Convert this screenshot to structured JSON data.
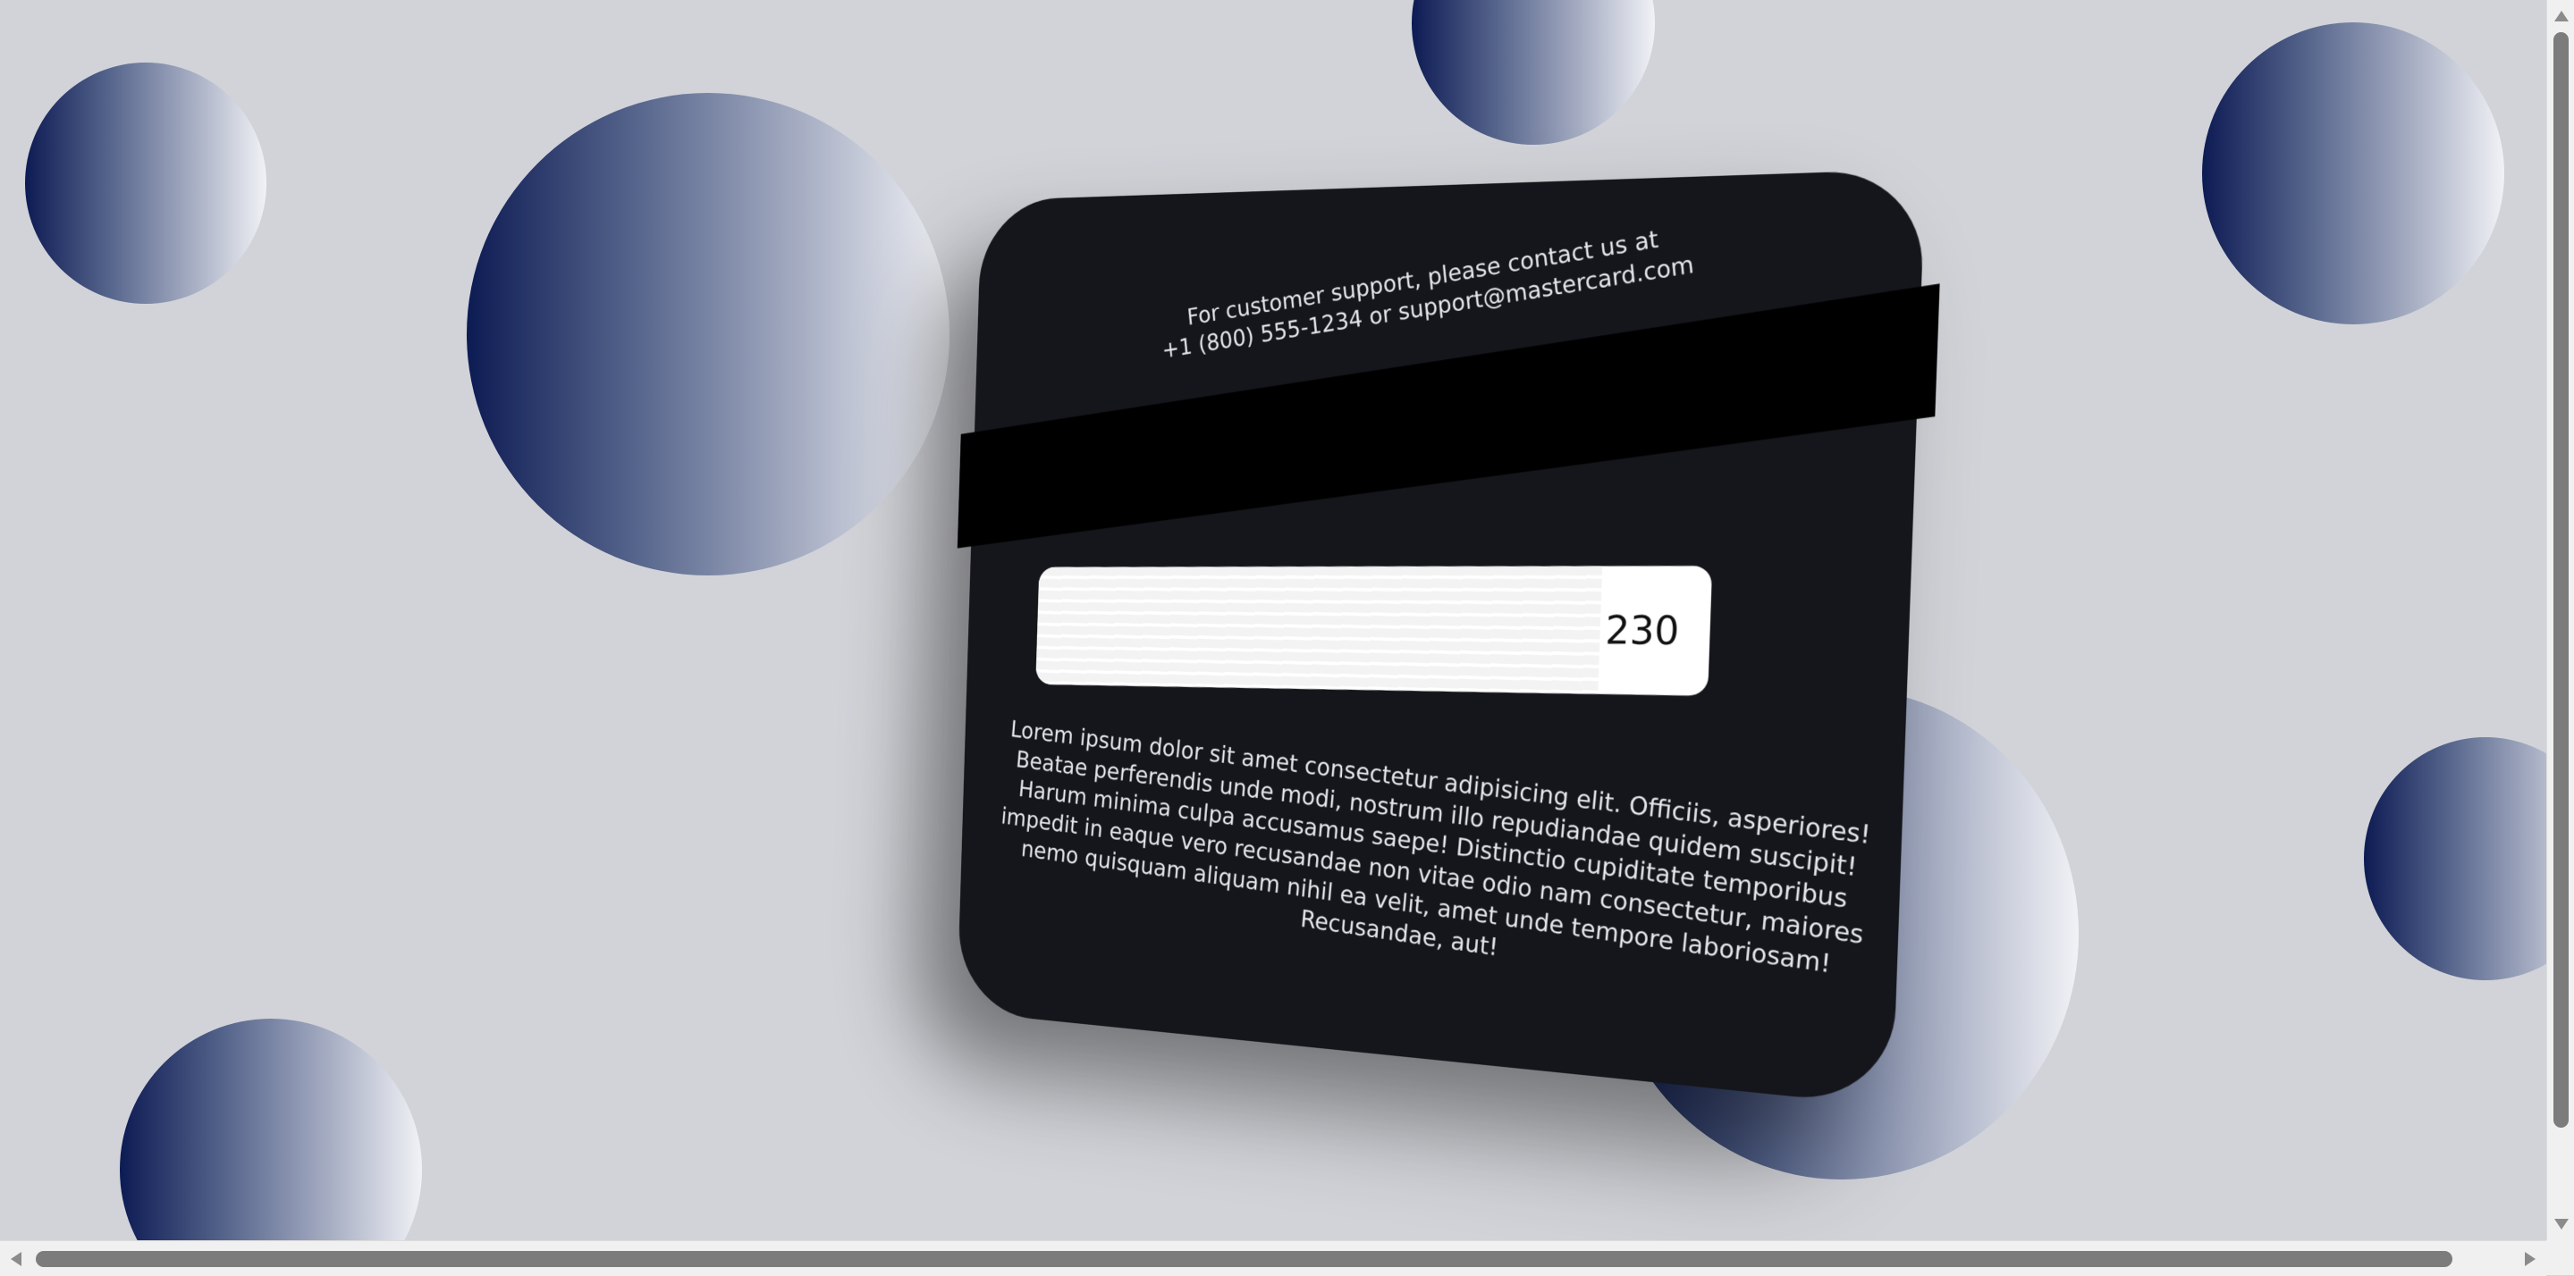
{
  "card": {
    "support_line1": "For customer support, please contact us at",
    "support_line2": "+1 (800) 555-1234 or support@mastercard.com",
    "cvv": "230",
    "legal_text": "Lorem ipsum dolor sit amet consectetur adipisicing elit. Officiis, asperiores! Beatae perferendis unde modi, nostrum illo repudiandae quidem suscipit! Harum minima culpa accusamus saepe! Distinctio cupiditate temporibus impedit in eaque vero recusandae non vitae odio nam consectetur, maiores nemo quisquam aliquam nihil ea velit, amet unde tempore laboriosam! Recusandae, aut!"
  },
  "colors": {
    "background": "#d1d3d8",
    "card": "#14161b",
    "magstripe": "#000000",
    "bubble_dark": "#0d1b54",
    "bubble_light": "#f1f2f6"
  },
  "scrollbars": {
    "vertical": "visible",
    "horizontal": "visible"
  }
}
